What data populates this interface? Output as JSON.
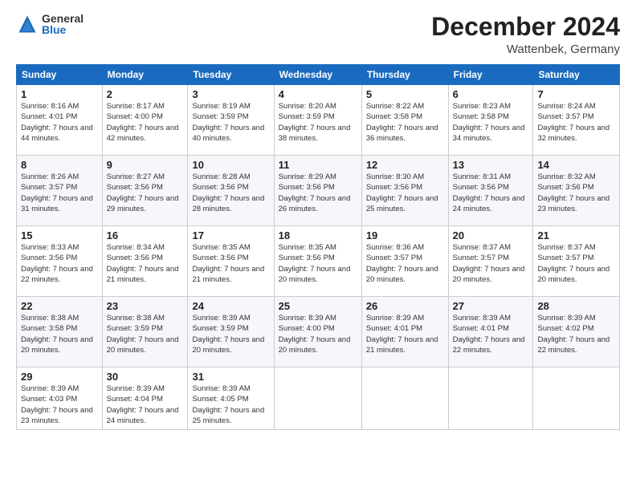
{
  "header": {
    "logo_general": "General",
    "logo_blue": "Blue",
    "month_title": "December 2024",
    "location": "Wattenbek, Germany"
  },
  "weekdays": [
    "Sunday",
    "Monday",
    "Tuesday",
    "Wednesday",
    "Thursday",
    "Friday",
    "Saturday"
  ],
  "weeks": [
    [
      {
        "day": 1,
        "sunrise": "Sunrise: 8:16 AM",
        "sunset": "Sunset: 4:01 PM",
        "daylight": "Daylight: 7 hours and 44 minutes."
      },
      {
        "day": 2,
        "sunrise": "Sunrise: 8:17 AM",
        "sunset": "Sunset: 4:00 PM",
        "daylight": "Daylight: 7 hours and 42 minutes."
      },
      {
        "day": 3,
        "sunrise": "Sunrise: 8:19 AM",
        "sunset": "Sunset: 3:59 PM",
        "daylight": "Daylight: 7 hours and 40 minutes."
      },
      {
        "day": 4,
        "sunrise": "Sunrise: 8:20 AM",
        "sunset": "Sunset: 3:59 PM",
        "daylight": "Daylight: 7 hours and 38 minutes."
      },
      {
        "day": 5,
        "sunrise": "Sunrise: 8:22 AM",
        "sunset": "Sunset: 3:58 PM",
        "daylight": "Daylight: 7 hours and 36 minutes."
      },
      {
        "day": 6,
        "sunrise": "Sunrise: 8:23 AM",
        "sunset": "Sunset: 3:58 PM",
        "daylight": "Daylight: 7 hours and 34 minutes."
      },
      {
        "day": 7,
        "sunrise": "Sunrise: 8:24 AM",
        "sunset": "Sunset: 3:57 PM",
        "daylight": "Daylight: 7 hours and 32 minutes."
      }
    ],
    [
      {
        "day": 8,
        "sunrise": "Sunrise: 8:26 AM",
        "sunset": "Sunset: 3:57 PM",
        "daylight": "Daylight: 7 hours and 31 minutes."
      },
      {
        "day": 9,
        "sunrise": "Sunrise: 8:27 AM",
        "sunset": "Sunset: 3:56 PM",
        "daylight": "Daylight: 7 hours and 29 minutes."
      },
      {
        "day": 10,
        "sunrise": "Sunrise: 8:28 AM",
        "sunset": "Sunset: 3:56 PM",
        "daylight": "Daylight: 7 hours and 28 minutes."
      },
      {
        "day": 11,
        "sunrise": "Sunrise: 8:29 AM",
        "sunset": "Sunset: 3:56 PM",
        "daylight": "Daylight: 7 hours and 26 minutes."
      },
      {
        "day": 12,
        "sunrise": "Sunrise: 8:30 AM",
        "sunset": "Sunset: 3:56 PM",
        "daylight": "Daylight: 7 hours and 25 minutes."
      },
      {
        "day": 13,
        "sunrise": "Sunrise: 8:31 AM",
        "sunset": "Sunset: 3:56 PM",
        "daylight": "Daylight: 7 hours and 24 minutes."
      },
      {
        "day": 14,
        "sunrise": "Sunrise: 8:32 AM",
        "sunset": "Sunset: 3:56 PM",
        "daylight": "Daylight: 7 hours and 23 minutes."
      }
    ],
    [
      {
        "day": 15,
        "sunrise": "Sunrise: 8:33 AM",
        "sunset": "Sunset: 3:56 PM",
        "daylight": "Daylight: 7 hours and 22 minutes."
      },
      {
        "day": 16,
        "sunrise": "Sunrise: 8:34 AM",
        "sunset": "Sunset: 3:56 PM",
        "daylight": "Daylight: 7 hours and 21 minutes."
      },
      {
        "day": 17,
        "sunrise": "Sunrise: 8:35 AM",
        "sunset": "Sunset: 3:56 PM",
        "daylight": "Daylight: 7 hours and 21 minutes."
      },
      {
        "day": 18,
        "sunrise": "Sunrise: 8:35 AM",
        "sunset": "Sunset: 3:56 PM",
        "daylight": "Daylight: 7 hours and 20 minutes."
      },
      {
        "day": 19,
        "sunrise": "Sunrise: 8:36 AM",
        "sunset": "Sunset: 3:57 PM",
        "daylight": "Daylight: 7 hours and 20 minutes."
      },
      {
        "day": 20,
        "sunrise": "Sunrise: 8:37 AM",
        "sunset": "Sunset: 3:57 PM",
        "daylight": "Daylight: 7 hours and 20 minutes."
      },
      {
        "day": 21,
        "sunrise": "Sunrise: 8:37 AM",
        "sunset": "Sunset: 3:57 PM",
        "daylight": "Daylight: 7 hours and 20 minutes."
      }
    ],
    [
      {
        "day": 22,
        "sunrise": "Sunrise: 8:38 AM",
        "sunset": "Sunset: 3:58 PM",
        "daylight": "Daylight: 7 hours and 20 minutes."
      },
      {
        "day": 23,
        "sunrise": "Sunrise: 8:38 AM",
        "sunset": "Sunset: 3:59 PM",
        "daylight": "Daylight: 7 hours and 20 minutes."
      },
      {
        "day": 24,
        "sunrise": "Sunrise: 8:39 AM",
        "sunset": "Sunset: 3:59 PM",
        "daylight": "Daylight: 7 hours and 20 minutes."
      },
      {
        "day": 25,
        "sunrise": "Sunrise: 8:39 AM",
        "sunset": "Sunset: 4:00 PM",
        "daylight": "Daylight: 7 hours and 20 minutes."
      },
      {
        "day": 26,
        "sunrise": "Sunrise: 8:39 AM",
        "sunset": "Sunset: 4:01 PM",
        "daylight": "Daylight: 7 hours and 21 minutes."
      },
      {
        "day": 27,
        "sunrise": "Sunrise: 8:39 AM",
        "sunset": "Sunset: 4:01 PM",
        "daylight": "Daylight: 7 hours and 22 minutes."
      },
      {
        "day": 28,
        "sunrise": "Sunrise: 8:39 AM",
        "sunset": "Sunset: 4:02 PM",
        "daylight": "Daylight: 7 hours and 22 minutes."
      }
    ],
    [
      {
        "day": 29,
        "sunrise": "Sunrise: 8:39 AM",
        "sunset": "Sunset: 4:03 PM",
        "daylight": "Daylight: 7 hours and 23 minutes."
      },
      {
        "day": 30,
        "sunrise": "Sunrise: 8:39 AM",
        "sunset": "Sunset: 4:04 PM",
        "daylight": "Daylight: 7 hours and 24 minutes."
      },
      {
        "day": 31,
        "sunrise": "Sunrise: 8:39 AM",
        "sunset": "Sunset: 4:05 PM",
        "daylight": "Daylight: 7 hours and 25 minutes."
      },
      null,
      null,
      null,
      null
    ]
  ]
}
